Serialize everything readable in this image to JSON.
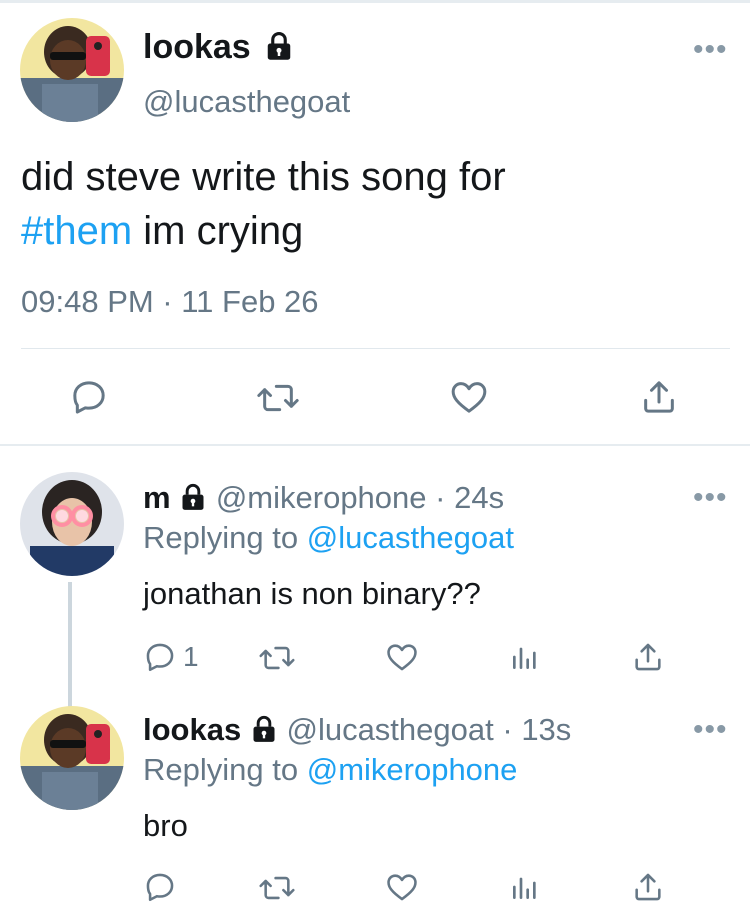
{
  "colors": {
    "text": "#14171a",
    "secondary": "#657786",
    "link": "#1da1f2",
    "border": "#e1e8ed"
  },
  "main_tweet": {
    "display_name": "lookas",
    "handle": "@lucasthegoat",
    "text_before": "did steve write this song for",
    "hashtag": "#them",
    "text_after": " im crying",
    "timestamp": "09:48 PM · 11 Feb 26",
    "icons": [
      "reply-icon",
      "retweet-icon",
      "like-icon",
      "share-icon"
    ]
  },
  "replies": [
    {
      "display_name": "m",
      "handle": "@mikerophone",
      "time": "24s",
      "replying_prefix": "Replying to",
      "replying_to": "@lucasthegoat",
      "text": "jonathan is non binary??",
      "reply_count": "1"
    },
    {
      "display_name": "lookas",
      "handle": "@lucasthegoat",
      "time": "13s",
      "replying_prefix": "Replying to",
      "replying_to": "@mikerophone",
      "text": "bro",
      "reply_count": ""
    }
  ],
  "separator": " · "
}
